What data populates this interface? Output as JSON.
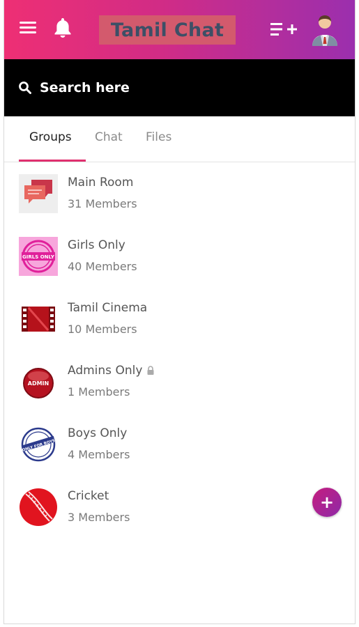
{
  "header": {
    "title": "Tamil Chat",
    "menu_icon": "hamburger-menu-icon",
    "notification_icon": "bell-icon",
    "add_icon": "playlist-add-icon",
    "avatar_icon": "user-avatar-icon"
  },
  "search": {
    "placeholder": "Search here",
    "icon": "search-icon"
  },
  "tabs": [
    {
      "label": "Groups",
      "active": true
    },
    {
      "label": "Chat",
      "active": false
    },
    {
      "label": "Files",
      "active": false
    }
  ],
  "groups": [
    {
      "name": "Main Room",
      "members": "31 Members",
      "icon": "chat-bubbles-icon",
      "locked": false
    },
    {
      "name": "Girls Only",
      "members": "40 Members",
      "icon": "girls-only-stamp-icon",
      "locked": false
    },
    {
      "name": "Tamil Cinema",
      "members": "10 Members",
      "icon": "film-strip-icon",
      "locked": false
    },
    {
      "name": "Admins Only",
      "members": "1 Members",
      "icon": "admin-badge-icon",
      "locked": true
    },
    {
      "name": "Boys Only",
      "members": "4 Members",
      "icon": "boys-only-stamp-icon",
      "locked": false
    },
    {
      "name": "Cricket",
      "members": "3 Members",
      "icon": "cricket-ball-icon",
      "locked": false
    }
  ],
  "stamp_text": {
    "girls": "GIRLS ONLY",
    "admin": "ADMIN",
    "boys": "ONLY FOR BOYS"
  },
  "fab": {
    "label": "+",
    "icon": "plus-icon"
  },
  "colors": {
    "header_start": "#ee2f74",
    "header_end": "#9b2fae",
    "accent": "#e0306f",
    "title_bg": "#d35a6d",
    "title_text": "#3d4f66"
  }
}
